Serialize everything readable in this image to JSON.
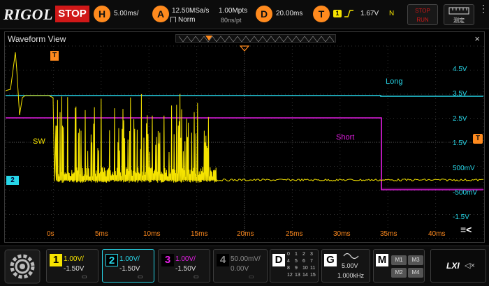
{
  "topbar": {
    "brand": "RIGOL",
    "run_state": "STOP",
    "horizontal": {
      "key": "H",
      "timebase": "5.00ms/"
    },
    "acquire": {
      "key": "A",
      "sample_rate": "12.50MSa/s",
      "mem_depth": "1.00Mpts",
      "mode": "Norm",
      "time_per_point": "80ns/pt"
    },
    "delay": {
      "key": "D",
      "value": "20.00ms"
    },
    "trigger": {
      "key": "T",
      "source": "1",
      "level": "1.67V",
      "coupling": "N"
    },
    "run_stop_button": {
      "line1": "STOP",
      "line2": "RUN"
    },
    "measure_button": {
      "label": "测定"
    }
  },
  "waveform_view": {
    "title": "Waveform View",
    "close_glyph": "×",
    "trigger_marker": "T",
    "right_trigger_marker": "T",
    "y_labels": [
      "4.5V",
      "3.5V",
      "2.5V",
      "1.5V",
      "500mV",
      "-500mV",
      "-1.5V"
    ],
    "x_labels": [
      "0s",
      "5ms",
      "10ms",
      "15ms",
      "20ms",
      "25ms",
      "30ms",
      "35ms",
      "40ms"
    ],
    "annotations": {
      "sw": "SW",
      "long": "Long",
      "short": "Short"
    },
    "ch2_marker": "2",
    "menu_glyph": "≡<"
  },
  "channels": [
    {
      "num": "1",
      "scale": "1.00V/",
      "offset": "-1.50V",
      "color": "#f5e300"
    },
    {
      "num": "2",
      "scale": "1.00V/",
      "offset": "-1.50V",
      "color": "#27d6e8"
    },
    {
      "num": "3",
      "scale": "1.00V/",
      "offset": "-1.50V",
      "color": "#e51ee5"
    },
    {
      "num": "4",
      "scale": "50.00mV/",
      "offset": "0.00V",
      "color": "#8a8a8a"
    }
  ],
  "digital": {
    "key": "D",
    "rows": [
      [
        "0",
        "1",
        "2",
        "3"
      ],
      [
        "4",
        "5",
        "6",
        "7"
      ],
      [
        "8",
        "9",
        "10",
        "11"
      ],
      [
        "12",
        "13",
        "14",
        "15"
      ]
    ]
  },
  "generator": {
    "key": "G",
    "amplitude": "5.00V",
    "frequency": "1.000kHz"
  },
  "math": {
    "key": "M",
    "buttons": [
      "M1",
      "M3",
      "M2",
      "M4"
    ]
  },
  "lxi": {
    "label": "LXI",
    "sound_glyph": "◁×"
  },
  "colors": {
    "ch1": "#f5e300",
    "ch2": "#27d6e8",
    "ch3": "#e51ee5",
    "accent": "#ff8a1e",
    "stop": "#d01818"
  },
  "icons": [
    "gear-icon",
    "sine-icon",
    "close-icon",
    "menu-icon",
    "speaker-mute-icon"
  ]
}
